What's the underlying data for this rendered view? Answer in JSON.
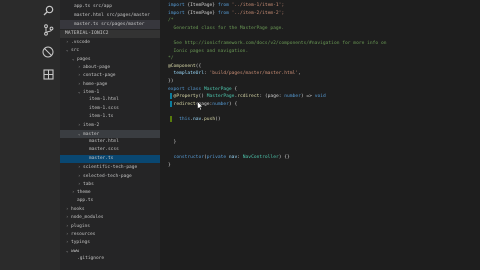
{
  "activity_bar": {
    "icons": [
      "search-icon",
      "git-icon",
      "debug-icon",
      "extensions-icon"
    ]
  },
  "sidebar": {
    "open_files": [
      "app.ts  src/app",
      "master.html  src/pages/master",
      "master.ts  src/pages/master"
    ],
    "section_title": "MATERIAL-IONIC2",
    "tree": [
      {
        "label": ".vscode",
        "depth": 1,
        "caret": "›"
      },
      {
        "label": "src",
        "depth": 1,
        "caret": "⌄"
      },
      {
        "label": "pages",
        "depth": 2,
        "caret": "⌄"
      },
      {
        "label": "about-page",
        "depth": 3,
        "caret": "›"
      },
      {
        "label": "contact-page",
        "depth": 3,
        "caret": "›"
      },
      {
        "label": "home-page",
        "depth": 3,
        "caret": "›"
      },
      {
        "label": "item-1",
        "depth": 3,
        "caret": "⌄"
      },
      {
        "label": "item-1.html",
        "depth": 4,
        "caret": ""
      },
      {
        "label": "item-1.scss",
        "depth": 4,
        "caret": ""
      },
      {
        "label": "item-1.ts",
        "depth": 4,
        "caret": ""
      },
      {
        "label": "item-2",
        "depth": 3,
        "caret": "›"
      },
      {
        "label": "master",
        "depth": 3,
        "caret": "⌄"
      },
      {
        "label": "master.html",
        "depth": 4,
        "caret": ""
      },
      {
        "label": "master.scss",
        "depth": 4,
        "caret": ""
      },
      {
        "label": "master.ts",
        "depth": 4,
        "caret": ""
      },
      {
        "label": "scientific-tech-page",
        "depth": 3,
        "caret": "›"
      },
      {
        "label": "selected-tech-page",
        "depth": 3,
        "caret": "›"
      },
      {
        "label": "tabs",
        "depth": 3,
        "caret": "›"
      },
      {
        "label": "theme",
        "depth": 2,
        "caret": "›"
      },
      {
        "label": "app.ts",
        "depth": 2,
        "caret": ""
      },
      {
        "label": "hooks",
        "depth": 1,
        "caret": "›"
      },
      {
        "label": "node_modules",
        "depth": 1,
        "caret": "›"
      },
      {
        "label": "plugins",
        "depth": 1,
        "caret": "›"
      },
      {
        "label": "resources",
        "depth": 1,
        "caret": "›"
      },
      {
        "label": "typings",
        "depth": 1,
        "caret": "›"
      },
      {
        "label": "www",
        "depth": 1,
        "caret": "⌄"
      },
      {
        "label": ".gitignore",
        "depth": 2,
        "caret": ""
      }
    ],
    "selected_index": 14,
    "focused_index": 11
  },
  "editor": {
    "lines": [
      [
        [
          "k",
          "import "
        ],
        [
          "d",
          "{ItemPage} "
        ],
        [
          "k",
          "from "
        ],
        [
          "s",
          "'../item-1/item-1';"
        ]
      ],
      [
        [
          "k",
          "import "
        ],
        [
          "d",
          "{ItemPage} "
        ],
        [
          "k",
          "from "
        ],
        [
          "s",
          "'../item-2/item-2';"
        ]
      ],
      [
        [
          "c",
          "/*"
        ]
      ],
      [
        [
          "c",
          "  Generated class for the MasterPage page."
        ]
      ],
      [
        [
          "c",
          ""
        ]
      ],
      [
        [
          "c",
          "  See http://ionicframework.com/docs/v2/components/#navigation for more info on"
        ]
      ],
      [
        [
          "c",
          "  Ionic pages and navigation."
        ]
      ],
      [
        [
          "c",
          "*/"
        ]
      ],
      [
        [
          "f",
          "@Component"
        ],
        [
          "d",
          "({"
        ]
      ],
      [
        [
          "p",
          "  templateUrl"
        ],
        [
          "d",
          ": "
        ],
        [
          "s",
          "'build/pages/master/master.html'"
        ],
        [
          "d",
          ","
        ]
      ],
      [
        [
          "d",
          "})"
        ]
      ],
      [
        [
          "k",
          "export class "
        ],
        [
          "t",
          "MasterPage "
        ],
        [
          "d",
          "{"
        ]
      ],
      [
        [
          "d",
          "  "
        ],
        [
          "f",
          "@Property"
        ],
        [
          "d",
          "() "
        ],
        [
          "t",
          "MasterPage"
        ],
        [
          "d",
          "."
        ],
        [
          "f",
          "rcdirect"
        ],
        [
          "d",
          ": (page: "
        ],
        [
          "k",
          "number"
        ],
        [
          "d",
          ") => "
        ],
        [
          "k",
          "void"
        ]
      ],
      [
        [
          "d",
          "  "
        ],
        [
          "f",
          "redirect"
        ],
        [
          "d",
          "(page:"
        ],
        [
          "k",
          "number"
        ],
        [
          "d",
          ") {"
        ]
      ],
      [
        [
          "d",
          ""
        ]
      ],
      [
        [
          "d",
          "    "
        ],
        [
          "k",
          "this"
        ],
        [
          "d",
          "."
        ],
        [
          "p",
          "nav"
        ],
        [
          "d",
          "."
        ],
        [
          "f",
          "push"
        ],
        [
          "d",
          "()"
        ]
      ],
      [
        [
          "d",
          ""
        ]
      ],
      [
        [
          "d",
          ""
        ]
      ],
      [
        [
          "d",
          "  }"
        ]
      ],
      [
        [
          "d",
          ""
        ]
      ],
      [
        [
          "d",
          "  "
        ],
        [
          "k",
          "constructor"
        ],
        [
          "d",
          "("
        ],
        [
          "k",
          "private "
        ],
        [
          "p",
          "nav"
        ],
        [
          "d",
          ": "
        ],
        [
          "t",
          "NavController"
        ],
        [
          "d",
          ") {}"
        ]
      ],
      [
        [
          "d",
          "}"
        ]
      ]
    ]
  },
  "colors": {
    "accent_modified": "#e2c08d",
    "selection_bg": "#094771"
  }
}
